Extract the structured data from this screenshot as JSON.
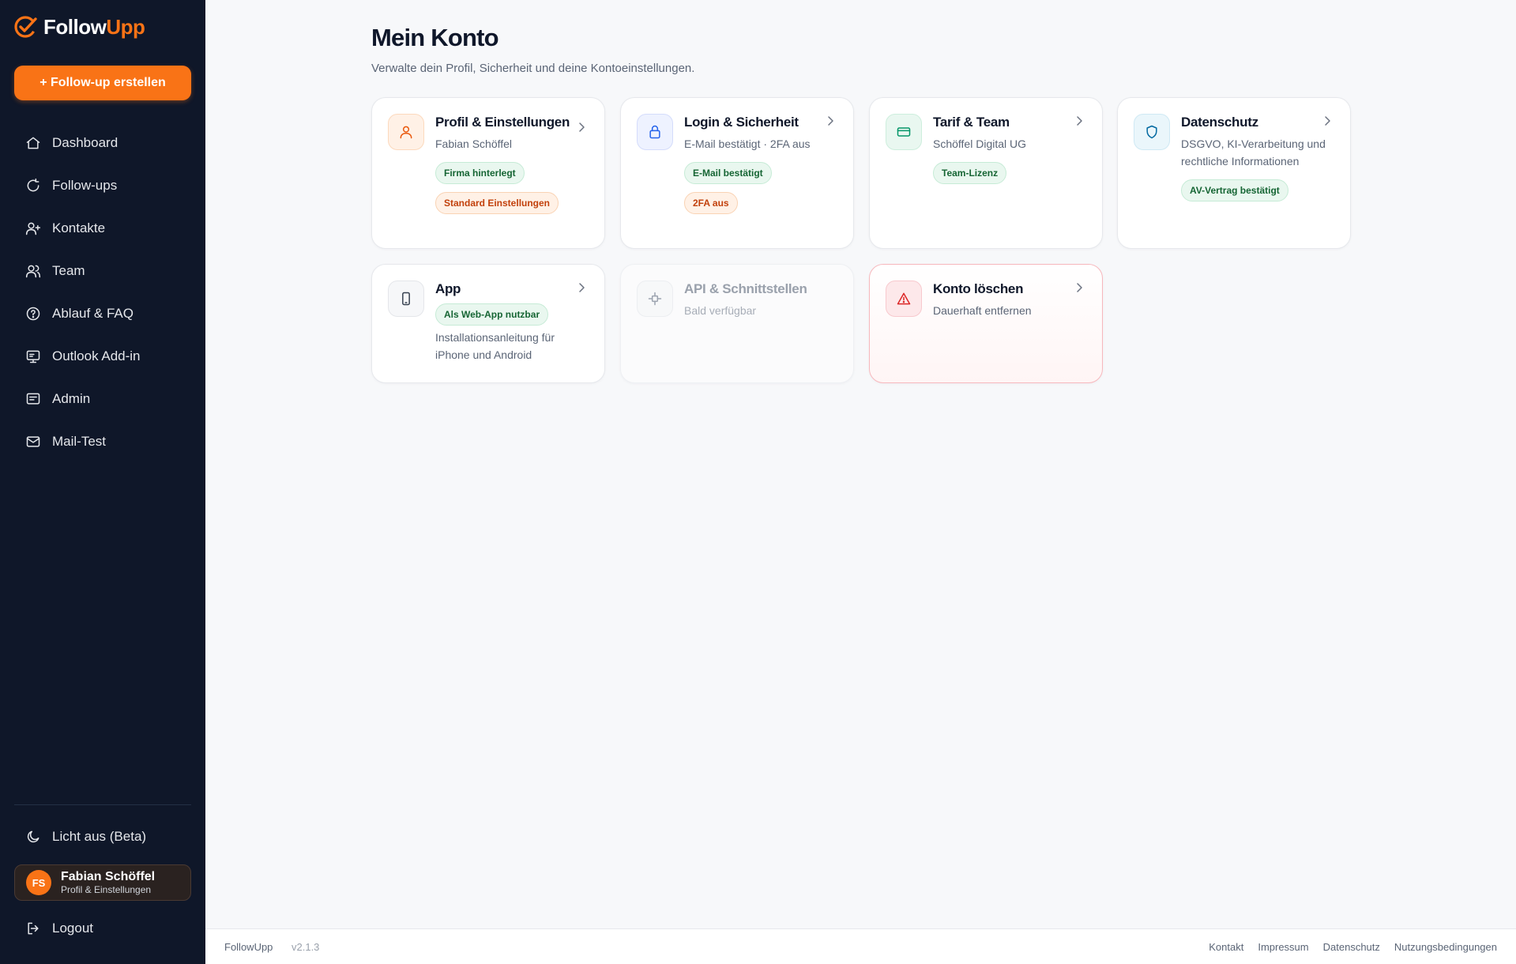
{
  "brand": {
    "name_part1": "Follow",
    "name_part2": "Upp",
    "accent": "#f97316",
    "sidebar_bg": "#0f1729"
  },
  "sidebar": {
    "create_button": "+ Follow-up erstellen",
    "items": [
      {
        "label": "Dashboard",
        "icon": "home-icon"
      },
      {
        "label": "Follow-ups",
        "icon": "refresh-icon"
      },
      {
        "label": "Kontakte",
        "icon": "user-plus-icon"
      },
      {
        "label": "Team",
        "icon": "users-icon"
      },
      {
        "label": "Ablauf & FAQ",
        "icon": "help-circle-icon"
      },
      {
        "label": "Outlook Add-in",
        "icon": "monitor-icon"
      },
      {
        "label": "Admin",
        "icon": "admin-icon"
      },
      {
        "label": "Mail-Test",
        "icon": "mail-icon"
      }
    ],
    "theme_toggle": "Licht aus (Beta)",
    "user": {
      "initials": "FS",
      "name": "Fabian Schöffel",
      "subtitle": "Profil & Einstellungen"
    },
    "logout": "Logout"
  },
  "main": {
    "title": "Mein Konto",
    "subtitle": "Verwalte dein Profil, Sicherheit und deine Kontoeinstellungen.",
    "cards": [
      {
        "title": "Profil & Einstellungen",
        "desc": "Fabian Schöffel",
        "badges": [
          "Firma hinterlegt",
          "Standard Einstellungen"
        ],
        "icon": "user-icon"
      },
      {
        "title": "Login & Sicherheit",
        "desc": "E-Mail bestätigt · 2FA aus",
        "badges": [
          "E-Mail bestätigt",
          "2FA aus"
        ],
        "icon": "lock-icon"
      },
      {
        "title": "Tarif & Team",
        "desc": "Schöffel Digital UG",
        "badges": [
          "Team-Lizenz"
        ],
        "icon": "credit-card-icon"
      },
      {
        "title": "Datenschutz",
        "desc": "DSGVO, KI-Verarbeitung und rechtliche Informationen",
        "badges": [
          "AV-Vertrag bestätigt"
        ],
        "icon": "shield-icon"
      },
      {
        "title": "App",
        "desc": "Installationsanleitung für iPhone und Android",
        "badges": [
          "Als Web-App nutzbar"
        ],
        "icon": "smartphone-icon"
      },
      {
        "title": "API & Schnittstellen",
        "desc": "Bald verfügbar",
        "badges": [],
        "icon": "plug-icon"
      },
      {
        "title": "Konto löschen",
        "desc": "Dauerhaft entfernen",
        "badges": [],
        "icon": "alert-triangle-icon"
      }
    ]
  },
  "footer": {
    "brand": "FollowUpp",
    "version": "v2.1.3",
    "links": [
      "Kontakt",
      "Impressum",
      "Datenschutz",
      "Nutzungsbedingungen"
    ]
  }
}
